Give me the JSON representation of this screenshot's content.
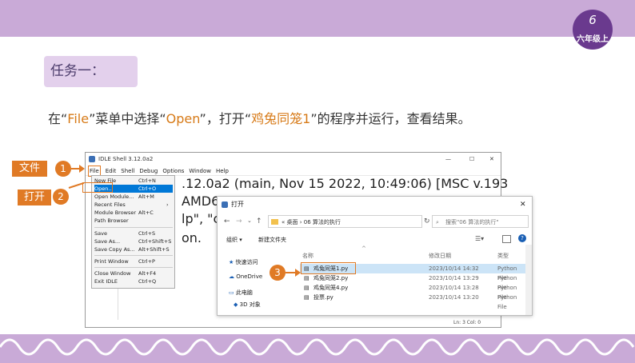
{
  "header": {
    "grade_number": "6",
    "grade_label": "六年级上"
  },
  "task_label": "任务一：",
  "instruction": {
    "p1": "在“",
    "file": "File",
    "p2": "”菜单中选择“",
    "open": "Open",
    "p3": "”，打开“",
    "prog": "鸡兔同笼1",
    "p4": "”的程序并运行，查看结果。"
  },
  "callouts": [
    {
      "label": "文件",
      "num": "1"
    },
    {
      "label": "打开",
      "num": "2"
    },
    {
      "num": "3"
    }
  ],
  "idle": {
    "title": "IDLE Shell 3.12.0a2",
    "menus": [
      "File",
      "Edit",
      "Shell",
      "Debug",
      "Options",
      "Window",
      "Help"
    ],
    "line1": ".12.0a2 (main, Nov 15 2022, 10:49:06) [MSC v.193",
    "line2": "AMD6",
    "line3": "lp\", \"c",
    "line4": "on.",
    "status": "Ln: 3   Col: 0"
  },
  "file_menu": [
    {
      "label": "New File",
      "shortcut": "Ctrl+N"
    },
    {
      "label": "Open...",
      "shortcut": "Ctrl+O"
    },
    {
      "label": "Open Module...",
      "shortcut": "Alt+M"
    },
    {
      "label": "Recent Files",
      "shortcut": "›"
    },
    {
      "label": "Module Browser",
      "shortcut": "Alt+C"
    },
    {
      "label": "Path Browser",
      "shortcut": ""
    },
    {
      "label": "Save",
      "shortcut": "Ctrl+S"
    },
    {
      "label": "Save As...",
      "shortcut": "Ctrl+Shift+S"
    },
    {
      "label": "Save Copy As...",
      "shortcut": "Alt+Shift+S"
    },
    {
      "label": "Print Window",
      "shortcut": "Ctrl+P"
    },
    {
      "label": "Close Window",
      "shortcut": "Alt+F4"
    },
    {
      "label": "Exit IDLE",
      "shortcut": "Ctrl+Q"
    }
  ],
  "dialog": {
    "title": "打开",
    "breadcrumb": "«  桌面  ›  06 算法的执行",
    "search_placeholder": "搜索\"06 算法的执行\"",
    "organize": "组织 ▾",
    "new_folder": "新建文件夹",
    "columns": {
      "name": "名称",
      "date": "修改日期",
      "type": "类型"
    },
    "nav": [
      "快速访问",
      "OneDrive",
      "此电脑",
      "3D 对象"
    ],
    "files": [
      {
        "name": "鸡兔同笼1.py",
        "date": "2023/10/14 14:32",
        "type": "Python File"
      },
      {
        "name": "鸡兔同笼2.py",
        "date": "2023/10/14 13:29",
        "type": "Python File"
      },
      {
        "name": "鸡兔同笼4.py",
        "date": "2023/10/14 13:28",
        "type": "Python File"
      },
      {
        "name": "投票.py",
        "date": "2023/10/14 13:20",
        "type": "Python File"
      }
    ]
  }
}
